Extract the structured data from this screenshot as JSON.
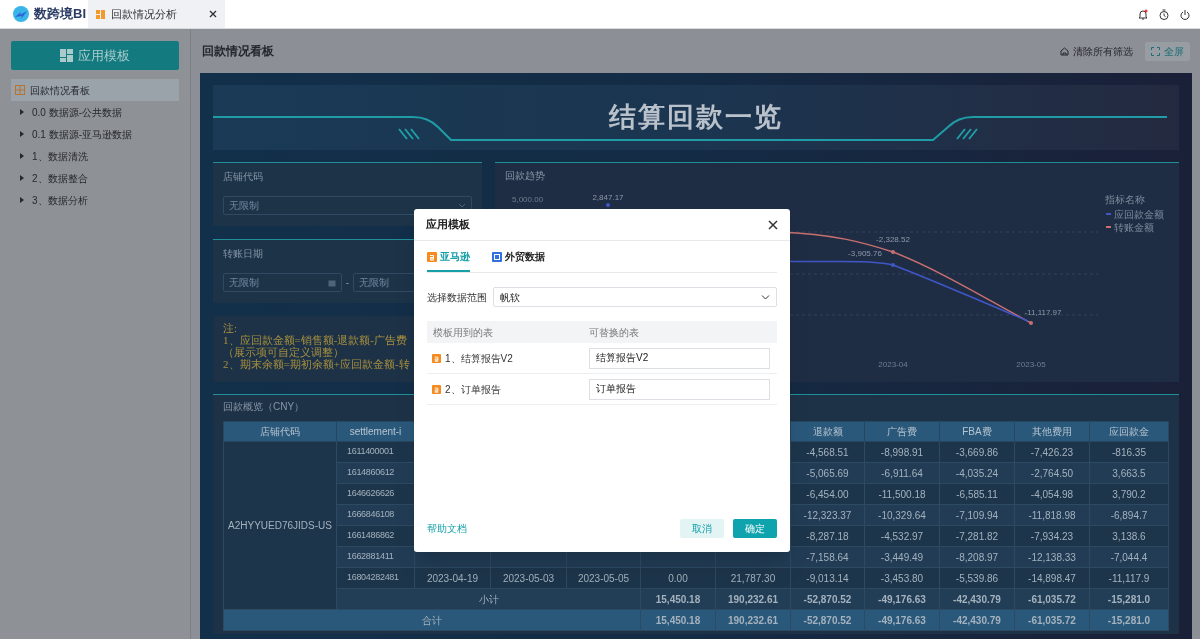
{
  "app": {
    "logo": "数跨境BI",
    "tabs": [
      {
        "label": "回款情况分析",
        "selected": true
      }
    ]
  },
  "sidebar": {
    "button": "应用模板",
    "items": [
      {
        "label": "回款情况看板",
        "kind": "dashboard",
        "selected": true
      },
      {
        "label": "0.0 数据源-公共数据",
        "kind": "folder",
        "selected": false,
        "expanded": false
      },
      {
        "label": "0.1 数据源-亚马逊数据",
        "kind": "folder",
        "selected": false,
        "expanded": false
      },
      {
        "label": "1、数据清洗",
        "kind": "folder",
        "selected": false,
        "expanded": false
      },
      {
        "label": "2、数据整合",
        "kind": "folder",
        "selected": false,
        "expanded": false
      },
      {
        "label": "3、数据分析",
        "kind": "folder",
        "selected": false,
        "expanded": false
      }
    ]
  },
  "page": {
    "title": "回款情况看板",
    "actions": [
      {
        "label": "清除所有筛选",
        "kind": "clear"
      },
      {
        "label": "全屏",
        "kind": "fullscreen"
      }
    ]
  },
  "dashboard": {
    "banner": "结算回款一览",
    "filters": [
      {
        "title": "店铺代码",
        "kind": "select",
        "placeholders": [
          "无限制"
        ]
      },
      {
        "title": "转账日期",
        "kind": "date_range",
        "placeholders": [
          "无限制",
          "无限制"
        ],
        "separator": "-"
      }
    ],
    "note": [
      "注:",
      "1、应回款金额=销售额-退款额-广告费",
      "（展示项可自定义调整）",
      "2、期末余额=期初余额+应回款金额-转"
    ],
    "chart": {
      "title": "回款趋势",
      "y_tick": "5,000.00",
      "x_labels": [
        "2023-04",
        "2023-05"
      ],
      "data_labels": [
        "2,847.17",
        "-2,328.52",
        "-3,905.76",
        "-11,117.97"
      ],
      "legend": {
        "title": "指标名称",
        "items": [
          {
            "label": "应回款金额",
            "color": "#4057c8"
          },
          {
            "label": "转账金额",
            "color": "#c86f6f"
          }
        ]
      }
    },
    "table": {
      "title": "回款概览（CNY）",
      "columns": [
        {
          "label": "店铺代码"
        },
        {
          "label": "settlement-i"
        },
        {},
        {},
        {},
        {},
        {},
        {
          "label": "退款额"
        },
        {
          "label": "广告费"
        },
        {
          "label": "FBA费"
        },
        {
          "label": "其他费用"
        },
        {
          "label": "应回款金"
        }
      ],
      "rows": [
        {
          "cells": [
            {
              "text": "A2HYYUED76JIDS-US",
              "rowspan": 8
            },
            "1611400001",
            null,
            null,
            null,
            null,
            null,
            "-4,568.51",
            "-8,998.91",
            "-3,669.86",
            "-7,426.23",
            "-816.35"
          ]
        },
        {
          "cells": [
            "1614860612",
            null,
            null,
            null,
            null,
            null,
            "-5,065.69",
            "-6,911.64",
            "-4,035.24",
            "-2,764.50",
            "3,663.5"
          ]
        },
        {
          "cells": [
            "1646626626",
            null,
            null,
            null,
            null,
            null,
            "-6,454.00",
            "-11,500.18",
            "-6,585.11",
            "-4,054.98",
            "3,790.2"
          ]
        },
        {
          "cells": [
            "1666846108",
            null,
            null,
            null,
            null,
            null,
            "-12,323.37",
            "-10,329.64",
            "-7,109.94",
            "-11,818.98",
            "-6,894.7"
          ]
        },
        {
          "cells": [
            "1661486862",
            null,
            null,
            null,
            null,
            null,
            "-8,287.18",
            "-4,532.97",
            "-7,281.82",
            "-7,934.23",
            "3,138.6"
          ]
        },
        {
          "cells": [
            "1662881411",
            null,
            null,
            null,
            null,
            null,
            "-7,158.64",
            "-3,449.49",
            "-8,208.97",
            "-12,138.33",
            "-7,044.4"
          ]
        },
        {
          "cells": [
            "16804282481",
            "2023-04-19",
            "2023-05-03",
            "2023-05-05",
            "0.00",
            "21,787.30",
            "-9,013.14",
            "-3,453.80",
            "-5,539.86",
            "-14,898.47",
            "-11,117.9"
          ]
        }
      ],
      "subtotal": {
        "label": "小计",
        "values": [
          "15,450.18",
          "190,232.61",
          "-52,870.52",
          "-49,176.63",
          "-42,430.79",
          "-61,035.72",
          "-15,281.0"
        ]
      },
      "total": {
        "label": "合计",
        "values": [
          "15,450.18",
          "190,232.61",
          "-52,870.52",
          "-49,176.63",
          "-42,430.79",
          "-61,035.72",
          "-15,281.0"
        ]
      }
    }
  },
  "modal": {
    "title": "应用模板",
    "tabs": [
      {
        "label": "亚马逊",
        "kind": "amazon",
        "selected": true
      },
      {
        "label": "外贸数据",
        "kind": "trade",
        "selected": false
      }
    ],
    "scope": {
      "label": "选择数据范围",
      "value": "帆软"
    },
    "columns": [
      "模板用到的表",
      "可替换的表"
    ],
    "rows": [
      {
        "source": "1、结算报告V2",
        "replacement": "结算报告V2"
      },
      {
        "source": "2、订单报告",
        "replacement": "订单报告"
      }
    ],
    "help_link": "帮助文档",
    "buttons": [
      {
        "label": "取消",
        "kind": "secondary"
      },
      {
        "label": "确定",
        "kind": "primary"
      }
    ]
  }
}
